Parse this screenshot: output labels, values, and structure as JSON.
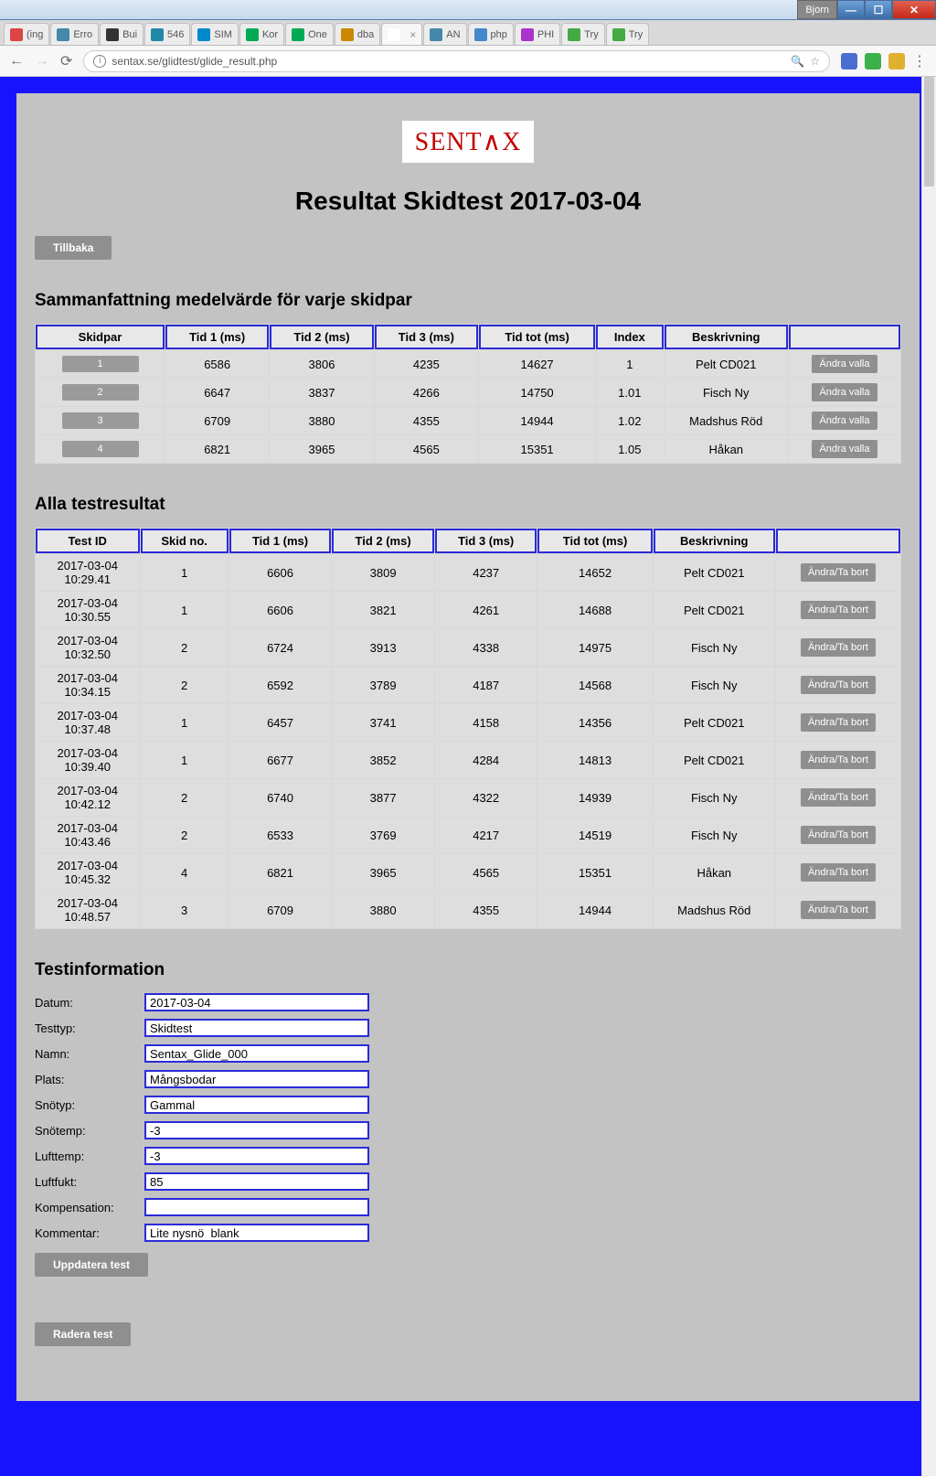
{
  "window": {
    "user": "Bjorn",
    "tabs": [
      "(ing",
      "Erro",
      "Bui",
      "546",
      "SIM",
      "Kor",
      "One",
      "dba",
      "",
      "AN",
      "php",
      "PHI",
      "Try",
      "Try"
    ],
    "active_tab_index": 8,
    "url": "sentax.se/glidtest/glide_result.php"
  },
  "page": {
    "logo_text": "SENTAX",
    "title": "Resultat Skidtest 2017-03-04",
    "back_btn": "Tillbaka"
  },
  "summary": {
    "heading": "Sammanfattning medelvärde för varje skidpar",
    "headers": [
      "Skidpar",
      "Tid 1 (ms)",
      "Tid 2 (ms)",
      "Tid 3 (ms)",
      "Tid tot (ms)",
      "Index",
      "Beskrivning",
      ""
    ],
    "rows": [
      {
        "no": "1",
        "t1": "6586",
        "t2": "3806",
        "t3": "4235",
        "tot": "14627",
        "idx": "1",
        "desc": "Pelt CD021",
        "btn": "Ändra valla"
      },
      {
        "no": "2",
        "t1": "6647",
        "t2": "3837",
        "t3": "4266",
        "tot": "14750",
        "idx": "1.01",
        "desc": "Fisch Ny",
        "btn": "Ändra valla"
      },
      {
        "no": "3",
        "t1": "6709",
        "t2": "3880",
        "t3": "4355",
        "tot": "14944",
        "idx": "1.02",
        "desc": "Madshus Röd",
        "btn": "Ändra valla"
      },
      {
        "no": "4",
        "t1": "6821",
        "t2": "3965",
        "t3": "4565",
        "tot": "15351",
        "idx": "1.05",
        "desc": "Håkan",
        "btn": "Ändra valla"
      }
    ]
  },
  "results": {
    "heading": "Alla testresultat",
    "headers": [
      "Test ID",
      "Skid no.",
      "Tid 1 (ms)",
      "Tid 2 (ms)",
      "Tid 3 (ms)",
      "Tid tot (ms)",
      "Beskrivning",
      ""
    ],
    "rows": [
      {
        "id": "2017-03-04 10:29.41",
        "no": "1",
        "t1": "6606",
        "t2": "3809",
        "t3": "4237",
        "tot": "14652",
        "desc": "Pelt CD021",
        "btn": "Ändra/Ta bort"
      },
      {
        "id": "2017-03-04 10:30.55",
        "no": "1",
        "t1": "6606",
        "t2": "3821",
        "t3": "4261",
        "tot": "14688",
        "desc": "Pelt CD021",
        "btn": "Ändra/Ta bort"
      },
      {
        "id": "2017-03-04 10:32.50",
        "no": "2",
        "t1": "6724",
        "t2": "3913",
        "t3": "4338",
        "tot": "14975",
        "desc": "Fisch Ny",
        "btn": "Ändra/Ta bort"
      },
      {
        "id": "2017-03-04 10:34.15",
        "no": "2",
        "t1": "6592",
        "t2": "3789",
        "t3": "4187",
        "tot": "14568",
        "desc": "Fisch Ny",
        "btn": "Ändra/Ta bort"
      },
      {
        "id": "2017-03-04 10:37.48",
        "no": "1",
        "t1": "6457",
        "t2": "3741",
        "t3": "4158",
        "tot": "14356",
        "desc": "Pelt CD021",
        "btn": "Ändra/Ta bort"
      },
      {
        "id": "2017-03-04 10:39.40",
        "no": "1",
        "t1": "6677",
        "t2": "3852",
        "t3": "4284",
        "tot": "14813",
        "desc": "Pelt CD021",
        "btn": "Ändra/Ta bort"
      },
      {
        "id": "2017-03-04 10:42.12",
        "no": "2",
        "t1": "6740",
        "t2": "3877",
        "t3": "4322",
        "tot": "14939",
        "desc": "Fisch Ny",
        "btn": "Ändra/Ta bort"
      },
      {
        "id": "2017-03-04 10:43.46",
        "no": "2",
        "t1": "6533",
        "t2": "3769",
        "t3": "4217",
        "tot": "14519",
        "desc": "Fisch Ny",
        "btn": "Ändra/Ta bort"
      },
      {
        "id": "2017-03-04 10:45.32",
        "no": "4",
        "t1": "6821",
        "t2": "3965",
        "t3": "4565",
        "tot": "15351",
        "desc": "Håkan",
        "btn": "Ändra/Ta bort"
      },
      {
        "id": "2017-03-04 10:48.57",
        "no": "3",
        "t1": "6709",
        "t2": "3880",
        "t3": "4355",
        "tot": "14944",
        "desc": "Madshus Röd",
        "btn": "Ändra/Ta bort"
      }
    ]
  },
  "info": {
    "heading": "Testinformation",
    "fields": [
      {
        "label": "Datum:",
        "value": "2017-03-04"
      },
      {
        "label": "Testtyp:",
        "value": "Skidtest"
      },
      {
        "label": "Namn:",
        "value": "Sentax_Glide_000"
      },
      {
        "label": "Plats:",
        "value": "Mångsbodar"
      },
      {
        "label": "Snötyp:",
        "value": "Gammal"
      },
      {
        "label": "Snötemp:",
        "value": "-3"
      },
      {
        "label": "Lufttemp:",
        "value": "-3"
      },
      {
        "label": "Luftfukt:",
        "value": "85"
      },
      {
        "label": "Kompensation:",
        "value": ""
      },
      {
        "label": "Kommentar:",
        "value": "Lite nysnö  blank"
      }
    ],
    "update_btn": "Uppdatera test",
    "delete_btn": "Radera test"
  }
}
